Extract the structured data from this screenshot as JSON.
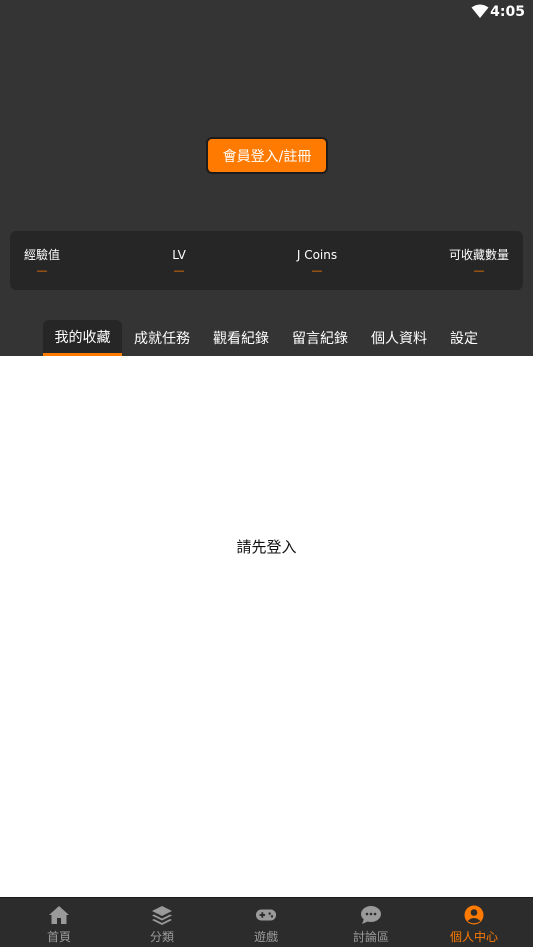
{
  "status_bar": {
    "time": "4:05"
  },
  "login_button": "會員登入/註冊",
  "stats": [
    {
      "label": "經驗值",
      "value": "—"
    },
    {
      "label": "LV",
      "value": "—"
    },
    {
      "label": "J Coins",
      "value": "—"
    },
    {
      "label": "可收藏數量",
      "value": "—"
    }
  ],
  "tabs": [
    "我的收藏",
    "成就任務",
    "觀看紀錄",
    "留言紀錄",
    "個人資料",
    "設定"
  ],
  "active_tab": "我的收藏",
  "content": {
    "message": "請先登入"
  },
  "bottom_nav": [
    {
      "label": "首頁",
      "icon": "home-icon"
    },
    {
      "label": "分類",
      "icon": "layers-icon"
    },
    {
      "label": "遊戲",
      "icon": "gamepad-icon"
    },
    {
      "label": "討論區",
      "icon": "chat-icon"
    },
    {
      "label": "個人中心",
      "icon": "user-circle-icon"
    }
  ],
  "active_nav": "個人中心",
  "colors": {
    "accent": "#ff7a00",
    "header_bg": "#343434",
    "panel_bg": "#262626",
    "nav_bg": "#2c2c2c"
  }
}
